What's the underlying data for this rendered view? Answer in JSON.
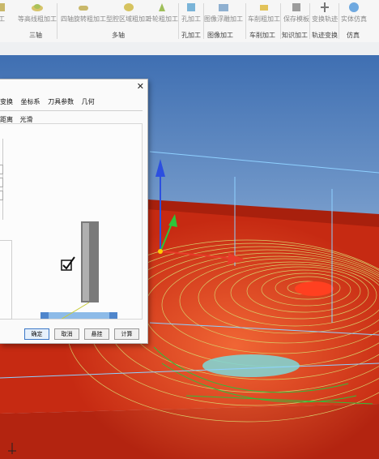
{
  "ribbon": {
    "items": [
      {
        "label": "工",
        "icon": "tool-icon"
      },
      {
        "label": "等高线粗加工",
        "icon": "contour-rough-icon"
      },
      {
        "label": "四轴旋转粗加工",
        "icon": "four-axis-rotary-icon"
      },
      {
        "label": "型腔区域粗加工",
        "icon": "cavity-area-icon"
      },
      {
        "label": "叶轮粗加工",
        "icon": "impeller-icon"
      },
      {
        "label": "孔加工",
        "icon": "hole-icon"
      },
      {
        "label": "图像浮雕加工",
        "icon": "image-relief-icon"
      },
      {
        "label": "车削粗加工",
        "icon": "turning-rough-icon"
      },
      {
        "label": "保存模板",
        "icon": "save-template-icon"
      },
      {
        "label": "变换轨迹",
        "icon": "transform-path-icon"
      },
      {
        "label": "实体仿真",
        "icon": "solid-sim-icon"
      }
    ],
    "groups": [
      "三轴",
      "多轴",
      "孔加工",
      "图像加工",
      "车削加工",
      "知识加工",
      "轨迹变换",
      "仿真"
    ]
  },
  "dialog": {
    "close": "✕",
    "tabs_row1": [
      "变换",
      "坐标系",
      "刀具参数",
      "几何"
    ],
    "tabs_row2": [
      "距离",
      "光滑"
    ],
    "buttons": {
      "ok": "确定",
      "cancel": "取消",
      "hide": "悬挂",
      "calc": "计算"
    }
  },
  "viewport": {
    "background_top": "#4a78b8",
    "background_bottom": "#e8f0f8",
    "part_color": "#cc2b12",
    "toolpath_color": "#c8c860",
    "axis_z_color": "#2c4fe0",
    "axis_x_color": "#e83b2a",
    "axis_y_color": "#2ec43a"
  }
}
